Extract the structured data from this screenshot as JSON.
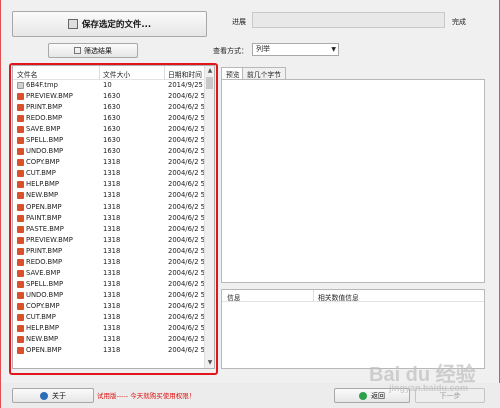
{
  "toolbar": {
    "save_label": "保存选定的文件...",
    "filter_label": "筛选结果"
  },
  "progress": {
    "label": "进展",
    "value": 0,
    "done_label": "完成"
  },
  "view_mode": {
    "label": "查看方式：",
    "selected": "列举"
  },
  "file_list": {
    "columns": [
      "文件名",
      "文件大小",
      "日期和时间"
    ],
    "rows": [
      {
        "name": "6B4F.tmp",
        "size": "10",
        "date": "2014/9/25",
        "icon": "tmp-file-icon"
      },
      {
        "name": "PREVIEW.BMP",
        "size": "1630",
        "date": "2004/6/2 5:",
        "icon": "bmp-file-icon"
      },
      {
        "name": "PRINT.BMP",
        "size": "1630",
        "date": "2004/6/2 5:",
        "icon": "bmp-file-icon"
      },
      {
        "name": "REDO.BMP",
        "size": "1630",
        "date": "2004/6/2 5:",
        "icon": "bmp-file-icon"
      },
      {
        "name": "SAVE.BMP",
        "size": "1630",
        "date": "2004/6/2 5:",
        "icon": "bmp-file-icon"
      },
      {
        "name": "SPELL.BMP",
        "size": "1630",
        "date": "2004/6/2 5:",
        "icon": "bmp-file-icon"
      },
      {
        "name": "UNDO.BMP",
        "size": "1630",
        "date": "2004/6/2 5:",
        "icon": "bmp-file-icon"
      },
      {
        "name": "COPY.BMP",
        "size": "1318",
        "date": "2004/6/2 5:",
        "icon": "bmp-file-icon"
      },
      {
        "name": "CUT.BMP",
        "size": "1318",
        "date": "2004/6/2 5:",
        "icon": "bmp-file-icon"
      },
      {
        "name": "HELP.BMP",
        "size": "1318",
        "date": "2004/6/2 5:",
        "icon": "bmp-file-icon"
      },
      {
        "name": "NEW.BMP",
        "size": "1318",
        "date": "2004/6/2 5:",
        "icon": "bmp-file-icon"
      },
      {
        "name": "OPEN.BMP",
        "size": "1318",
        "date": "2004/6/2 5:",
        "icon": "bmp-file-icon"
      },
      {
        "name": "PAINT.BMP",
        "size": "1318",
        "date": "2004/6/2 5:",
        "icon": "bmp-file-icon"
      },
      {
        "name": "PASTE.BMP",
        "size": "1318",
        "date": "2004/6/2 5:",
        "icon": "bmp-file-icon"
      },
      {
        "name": "PREVIEW.BMP",
        "size": "1318",
        "date": "2004/6/2 5:",
        "icon": "bmp-file-icon"
      },
      {
        "name": "PRINT.BMP",
        "size": "1318",
        "date": "2004/6/2 5:",
        "icon": "bmp-file-icon"
      },
      {
        "name": "REDO.BMP",
        "size": "1318",
        "date": "2004/6/2 5:",
        "icon": "bmp-file-icon"
      },
      {
        "name": "SAVE.BMP",
        "size": "1318",
        "date": "2004/6/2 5:",
        "icon": "bmp-file-icon"
      },
      {
        "name": "SPELL.BMP",
        "size": "1318",
        "date": "2004/6/2 5:",
        "icon": "bmp-file-icon"
      },
      {
        "name": "UNDO.BMP",
        "size": "1318",
        "date": "2004/6/2 5:",
        "icon": "bmp-file-icon"
      },
      {
        "name": "COPY.BMP",
        "size": "1318",
        "date": "2004/6/2 5:",
        "icon": "bmp-file-icon"
      },
      {
        "name": "CUT.BMP",
        "size": "1318",
        "date": "2004/6/2 5:",
        "icon": "bmp-file-icon"
      },
      {
        "name": "HELP.BMP",
        "size": "1318",
        "date": "2004/6/2 5:",
        "icon": "bmp-file-icon"
      },
      {
        "name": "NEW.BMP",
        "size": "1318",
        "date": "2004/6/2 5:",
        "icon": "bmp-file-icon"
      },
      {
        "name": "OPEN.BMP",
        "size": "1318",
        "date": "2004/6/2 5:",
        "icon": "bmp-file-icon"
      }
    ]
  },
  "tabs": [
    {
      "label": "预览",
      "active": true
    },
    {
      "label": "前几个字节",
      "active": false
    }
  ],
  "info_table": {
    "columns": [
      "信息",
      "相关数值信息"
    ]
  },
  "footer": {
    "about_label": "关于",
    "trial_text": "试用版----- 今天就购买使用权限！",
    "back_label": "返回",
    "next_label": "下一步"
  },
  "watermark": {
    "text": "Bai du 经验",
    "sub": "jingyan.baidu.com"
  },
  "colors": {
    "highlight_frame": "#e0161c",
    "trial_text": "#e01010",
    "bmp_icon": "#d9502b"
  }
}
